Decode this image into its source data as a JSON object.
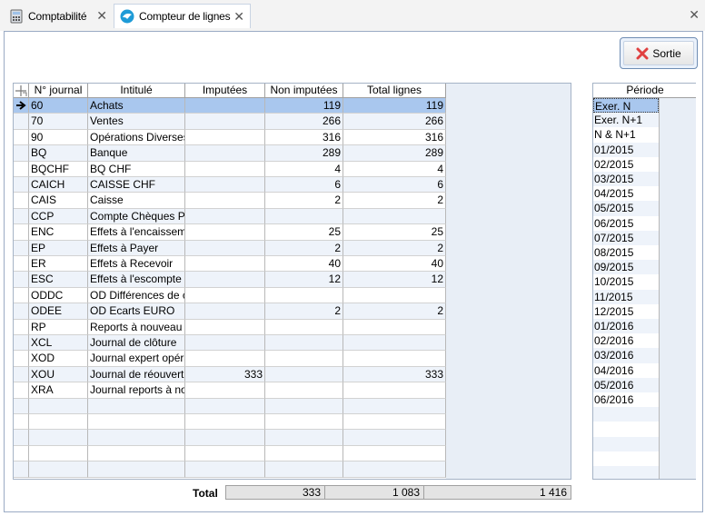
{
  "tabs": [
    {
      "label": "Comptabilité",
      "icon": "calculator-icon"
    },
    {
      "label": "Compteur de lignes",
      "icon": "bird-icon"
    }
  ],
  "toolbar": {
    "exit_label": "Sortie"
  },
  "grid": {
    "headers": [
      "N° journal",
      "Intitulé",
      "Imputées",
      "Non imputées",
      "Total lignes"
    ],
    "rows": [
      {
        "journal": "60",
        "intitule": "Achats",
        "imputees": "",
        "non_imputees": "119",
        "total": "119"
      },
      {
        "journal": "70",
        "intitule": "Ventes",
        "imputees": "",
        "non_imputees": "266",
        "total": "266"
      },
      {
        "journal": "90",
        "intitule": "Opérations Diverses",
        "imputees": "",
        "non_imputees": "316",
        "total": "316"
      },
      {
        "journal": "BQ",
        "intitule": "Banque",
        "imputees": "",
        "non_imputees": "289",
        "total": "289"
      },
      {
        "journal": "BQCHF",
        "intitule": "BQ CHF",
        "imputees": "",
        "non_imputees": "4",
        "total": "4"
      },
      {
        "journal": "CAICH",
        "intitule": "CAISSE CHF",
        "imputees": "",
        "non_imputees": "6",
        "total": "6"
      },
      {
        "journal": "CAIS",
        "intitule": "Caisse",
        "imputees": "",
        "non_imputees": "2",
        "total": "2"
      },
      {
        "journal": "CCP",
        "intitule": "Compte Chèques Postaux",
        "imputees": "",
        "non_imputees": "",
        "total": ""
      },
      {
        "journal": "ENC",
        "intitule": "Effets à l'encaissement",
        "imputees": "",
        "non_imputees": "25",
        "total": "25"
      },
      {
        "journal": "EP",
        "intitule": "Effets à Payer",
        "imputees": "",
        "non_imputees": "2",
        "total": "2"
      },
      {
        "journal": "ER",
        "intitule": "Effets à Recevoir",
        "imputees": "",
        "non_imputees": "40",
        "total": "40"
      },
      {
        "journal": "ESC",
        "intitule": "Effets à l'escompte",
        "imputees": "",
        "non_imputees": "12",
        "total": "12"
      },
      {
        "journal": "ODDC",
        "intitule": "OD Différences de change",
        "imputees": "",
        "non_imputees": "",
        "total": ""
      },
      {
        "journal": "ODEE",
        "intitule": "OD Ecarts EURO",
        "imputees": "",
        "non_imputees": "2",
        "total": "2"
      },
      {
        "journal": "RP",
        "intitule": "Reports à nouveau",
        "imputees": "",
        "non_imputees": "",
        "total": ""
      },
      {
        "journal": "XCL",
        "intitule": "Journal de clôture",
        "imputees": "",
        "non_imputees": "",
        "total": ""
      },
      {
        "journal": "XOD",
        "intitule": "Journal expert opérations",
        "imputees": "",
        "non_imputees": "",
        "total": ""
      },
      {
        "journal": "XOU",
        "intitule": "Journal de réouverture",
        "imputees": "333",
        "non_imputees": "",
        "total": "333"
      },
      {
        "journal": "XRA",
        "intitule": "Journal reports à nouveau",
        "imputees": "",
        "non_imputees": "",
        "total": ""
      }
    ],
    "empty_rows": 5
  },
  "periods": {
    "header": "Période",
    "items": [
      "Exer. N",
      "Exer. N+1",
      "N & N+1",
      "01/2015",
      "02/2015",
      "03/2015",
      "04/2015",
      "05/2015",
      "06/2015",
      "07/2015",
      "08/2015",
      "09/2015",
      "10/2015",
      "11/2015",
      "12/2015",
      "01/2016",
      "02/2016",
      "03/2016",
      "04/2016",
      "05/2016",
      "06/2016"
    ],
    "selected_index": 0
  },
  "totals": {
    "label": "Total",
    "imputees": "333",
    "non_imputees": "1 083",
    "total": "1 416"
  },
  "colors": {
    "selection": "#a9c7ee",
    "row_alt": "#eef3fa",
    "exit_icon": "#e04040"
  }
}
